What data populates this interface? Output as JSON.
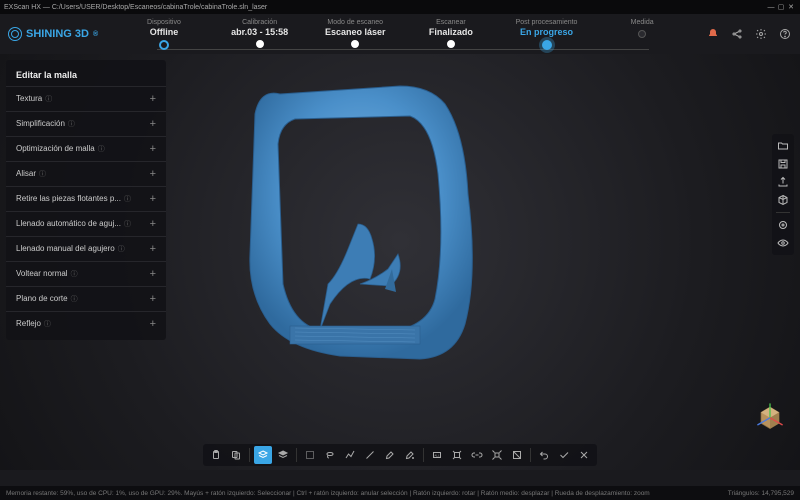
{
  "window": {
    "title": "EXScan HX — C:/Users/USER/Desktop/Escaneos/cabinaTrole/cabinaTrole.sln_laser"
  },
  "brand": "SHINING 3D",
  "stages": [
    {
      "label": "Dispositivo",
      "value": "Offline",
      "state": "off"
    },
    {
      "label": "Calibración",
      "value": "abr.03 - 15:58",
      "state": "done"
    },
    {
      "label": "Modo de escaneo",
      "value": "Escaneo láser",
      "state": "done"
    },
    {
      "label": "Escanear",
      "value": "Finalizado",
      "state": "done"
    },
    {
      "label": "Post procesamiento",
      "value": "En progreso",
      "state": "active"
    },
    {
      "label": "Medida",
      "value": "",
      "state": ""
    }
  ],
  "sidebar": {
    "title": "Editar la malla",
    "items": [
      {
        "label": "Textura"
      },
      {
        "label": "Simplificación"
      },
      {
        "label": "Optimización de malla"
      },
      {
        "label": "Alisar"
      },
      {
        "label": "Retire las piezas flotantes p..."
      },
      {
        "label": "Llenado automático de aguj..."
      },
      {
        "label": "Llenado manual del agujero"
      },
      {
        "label": "Voltear normal"
      },
      {
        "label": "Plano de corte"
      },
      {
        "label": "Reflejo"
      }
    ]
  },
  "right_tools": [
    "folder-icon",
    "save-icon",
    "export-icon",
    "cube-icon",
    "sep",
    "target-icon",
    "eye-icon"
  ],
  "toolbar": [
    "clipboard-icon",
    "clipboard-copy-icon",
    "tsep",
    "layers-back-icon",
    "layers-front-icon",
    "tsep",
    "rect-select-icon",
    "lasso-icon",
    "polyline-icon",
    "line-icon",
    "brush-icon",
    "brush-plus-icon",
    "tsep",
    "all-icon",
    "grow-icon",
    "link-icon",
    "shrink-icon",
    "invert-icon",
    "tsep",
    "undo-icon",
    "confirm-icon",
    "cancel-icon"
  ],
  "toolbar_active_index": 3,
  "status": {
    "left": "Memoria restante: 59%, uso de CPU: 1%, uso de GPU: 29%.   Mayús + ratón izquierdo: Seleccionar | Ctrl + ratón izquierdo: anular selección | Ratón izquierdo: rotar | Ratón medio: desplazar | Rueda de desplazamiento: zoom",
    "right": "Triángulos: 14,795,529"
  }
}
